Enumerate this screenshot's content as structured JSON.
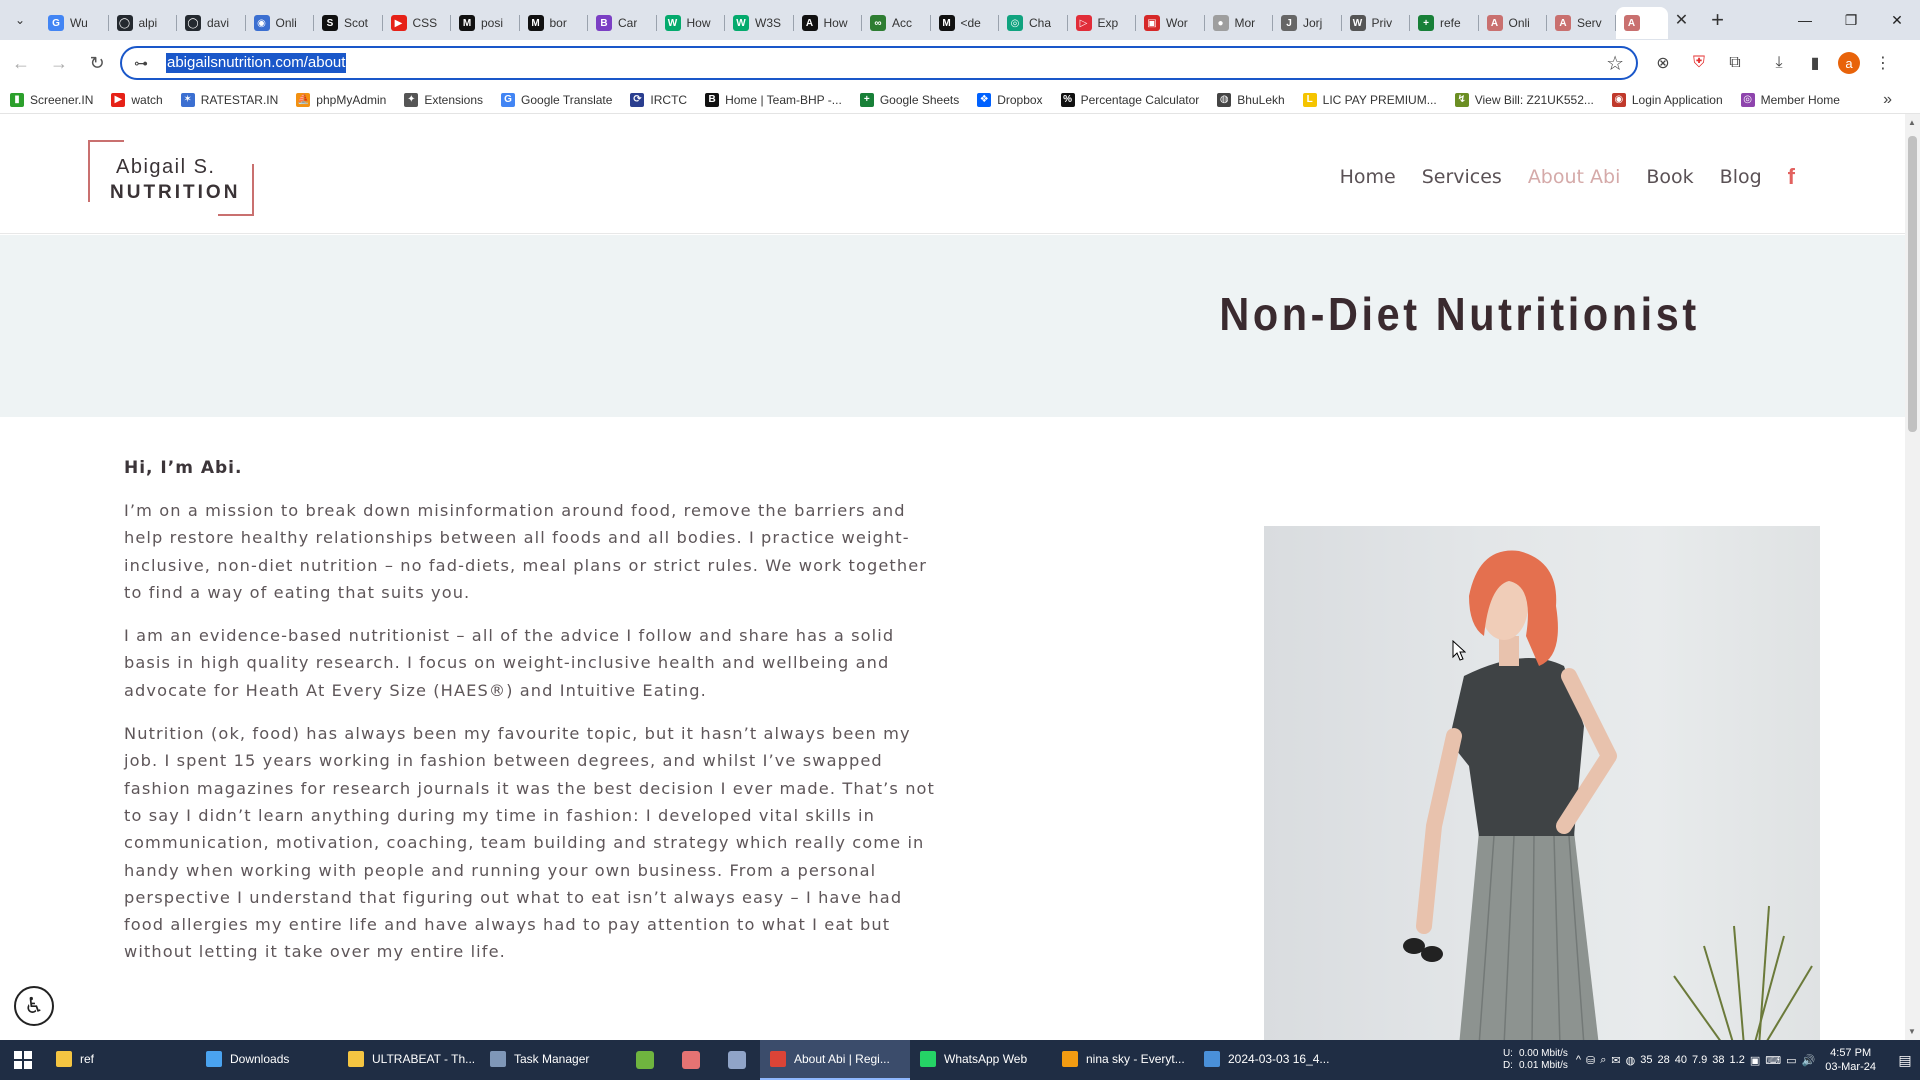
{
  "browser": {
    "tabs": [
      {
        "title": "Wu",
        "color": "#4285f4",
        "glyph": "G"
      },
      {
        "title": "alpi",
        "color": "#24292f",
        "glyph": "◯"
      },
      {
        "title": "davi",
        "color": "#24292f",
        "glyph": "◯"
      },
      {
        "title": "Onli",
        "color": "#3b6fd1",
        "glyph": "◉"
      },
      {
        "title": "Scot",
        "color": "#111111",
        "glyph": "S"
      },
      {
        "title": "CSS",
        "color": "#e62117",
        "glyph": "▶"
      },
      {
        "title": "posi",
        "color": "#111111",
        "glyph": "M"
      },
      {
        "title": "bor",
        "color": "#111111",
        "glyph": "M"
      },
      {
        "title": "Car",
        "color": "#7b3fc4",
        "glyph": "B"
      },
      {
        "title": "How",
        "color": "#04aa6d",
        "glyph": "W"
      },
      {
        "title": "W3S",
        "color": "#04aa6d",
        "glyph": "W"
      },
      {
        "title": "How",
        "color": "#111111",
        "glyph": "A"
      },
      {
        "title": "Acc",
        "color": "#2e7d32",
        "glyph": "∞"
      },
      {
        "title": "<de",
        "color": "#111111",
        "glyph": "M"
      },
      {
        "title": "Cha",
        "color": "#10a37f",
        "glyph": "◎"
      },
      {
        "title": "Exp",
        "color": "#e12d39",
        "glyph": "▷"
      },
      {
        "title": "Wor",
        "color": "#d62828",
        "glyph": "▣"
      },
      {
        "title": "Mor",
        "color": "#9e9e9e",
        "glyph": "●"
      },
      {
        "title": "Jorj",
        "color": "#666666",
        "glyph": "J"
      },
      {
        "title": "Priv",
        "color": "#555555",
        "glyph": "W"
      },
      {
        "title": "refe",
        "color": "#188038",
        "glyph": "+"
      },
      {
        "title": "Onli",
        "color": "#c9706f",
        "glyph": "A"
      },
      {
        "title": "Serv",
        "color": "#c9706f",
        "glyph": "A"
      }
    ],
    "active_tab_glyph": "A",
    "active_tab_color": "#c9706f",
    "close_glyph": "✕",
    "new_tab_glyph": "+",
    "window_controls": {
      "minimize": "—",
      "maximize": "❐",
      "close": "✕"
    },
    "nav": {
      "back": "←",
      "forward": "→",
      "reload": "↻"
    },
    "url": "abigailsnutrition.com/about",
    "site_info_icon": "⊶",
    "star_icon": "☆",
    "toolbar_icons": {
      "extension_1": "⊗",
      "brave_shield": "⛨",
      "extensions": "⧉",
      "download": "⤓",
      "sidebar": "▮",
      "profile": "a",
      "menu": "⋮"
    }
  },
  "bookmarks": [
    {
      "label": "Screener.IN",
      "color": "#2ca02c",
      "glyph": "▮"
    },
    {
      "label": "watch",
      "color": "#e62117",
      "glyph": "▶"
    },
    {
      "label": "RATESTAR.IN",
      "color": "#3b6fd1",
      "glyph": "✶"
    },
    {
      "label": "phpMyAdmin",
      "color": "#f29111",
      "glyph": "⛵"
    },
    {
      "label": "Extensions",
      "color": "#555555",
      "glyph": "✦"
    },
    {
      "label": "Google Translate",
      "color": "#4285f4",
      "glyph": "G"
    },
    {
      "label": "IRCTC",
      "color": "#2a3e8f",
      "glyph": "⟳"
    },
    {
      "label": "Home | Team-BHP -...",
      "color": "#111111",
      "glyph": "B"
    },
    {
      "label": "Google Sheets",
      "color": "#188038",
      "glyph": "+"
    },
    {
      "label": "Dropbox",
      "color": "#0061fe",
      "glyph": "❖"
    },
    {
      "label": "Percentage Calculator",
      "color": "#111111",
      "glyph": "%"
    },
    {
      "label": "BhuLekh",
      "color": "#444444",
      "glyph": "◍"
    },
    {
      "label": "LIC PAY PREMIUM...",
      "color": "#f5c400",
      "glyph": "L"
    },
    {
      "label": "View Bill: Z21UK552...",
      "color": "#6b8e23",
      "glyph": "↯"
    },
    {
      "label": "Login Application",
      "color": "#c0392b",
      "glyph": "◉"
    },
    {
      "label": "Member Home",
      "color": "#8e44ad",
      "glyph": "◎"
    }
  ],
  "bookmarks_more": "»",
  "site": {
    "logo": {
      "line1": "Abigail S.",
      "line2": "NUTRITION"
    },
    "nav": [
      "Home",
      "Services",
      "About Abi",
      "Book",
      "Blog"
    ],
    "active_nav": "About Abi",
    "facebook_glyph": "f",
    "hero_title": "Non-Diet Nutritionist",
    "greeting": "Hi, I’m Abi.",
    "paragraphs": [
      "I’m on a mission to break down misinformation around food, remove the barriers and help restore healthy relationships between all foods and all bodies. I practice weight-inclusive, non-diet nutrition – no fad-diets, meal plans or strict rules. We work together to find a way of eating that suits you.",
      "I am an evidence-based nutritionist – all of the advice I follow and share has a solid basis in high quality research. I focus on weight-inclusive health and wellbeing and advocate for Heath At Every Size (HAES®) and Intuitive Eating.",
      "Nutrition (ok, food) has always been my favourite topic, but it hasn’t always been my job. I spent 15 years working in fashion between degrees, and whilst I’ve swapped fashion magazines for research journals it was the best decision I ever made. That’s not to say I didn’t learn anything during my time in fashion: I developed vital skills in communication, motivation, coaching, team building and strategy which really come in handy when working with people and running your own business. From a personal perspective I understand that figuring out what to eat isn’t always easy – I have had food allergies my entire life and have always had to pay attention to what I eat but without letting it take over my entire life."
    ],
    "accessibility_glyph": "♿",
    "colors": {
      "accent": "#c9706f",
      "hero_bg": "#eef3f4",
      "title": "#3a2a2f",
      "active_nav": "#d5aaa9"
    }
  },
  "taskbar": {
    "start_glyph": "⊞",
    "items": [
      {
        "label": "ref",
        "color": "#f4c542",
        "active": false
      },
      {
        "label": "Downloads",
        "color": "#4aa3f0",
        "active": false
      },
      {
        "label": "ULTRABEAT - Th...",
        "color": "#f4c542",
        "active": false
      },
      {
        "label": "Task Manager",
        "color": "#7f97b8",
        "active": false
      }
    ],
    "pinned": [
      {
        "color": "#6fb43f"
      },
      {
        "color": "#e57373"
      },
      {
        "color": "#90a4c8"
      }
    ],
    "items2": [
      {
        "label": "About Abi | Regi...",
        "color": "#db4437",
        "active": true
      },
      {
        "label": "WhatsApp Web",
        "color": "#25d366",
        "active": false
      },
      {
        "label": "nina sky - Everyt...",
        "color": "#f39c12",
        "active": false
      },
      {
        "label": "2024-03-03 16_4...",
        "color": "#4a90d9",
        "active": false
      }
    ],
    "net": {
      "up_label": "U:",
      "up": "0.00 Mbit/s",
      "down_label": "D:",
      "down": "0.01 Mbit/s"
    },
    "tray": [
      "^",
      "⛁",
      "⌕",
      "✉",
      "◍",
      "35",
      "28",
      "40",
      "7.9",
      "38",
      "1.2",
      "▣",
      "⌨",
      "▭",
      "🔊"
    ],
    "time": "4:57 PM",
    "date": "03-Mar-24",
    "notification_glyph": "▤"
  }
}
